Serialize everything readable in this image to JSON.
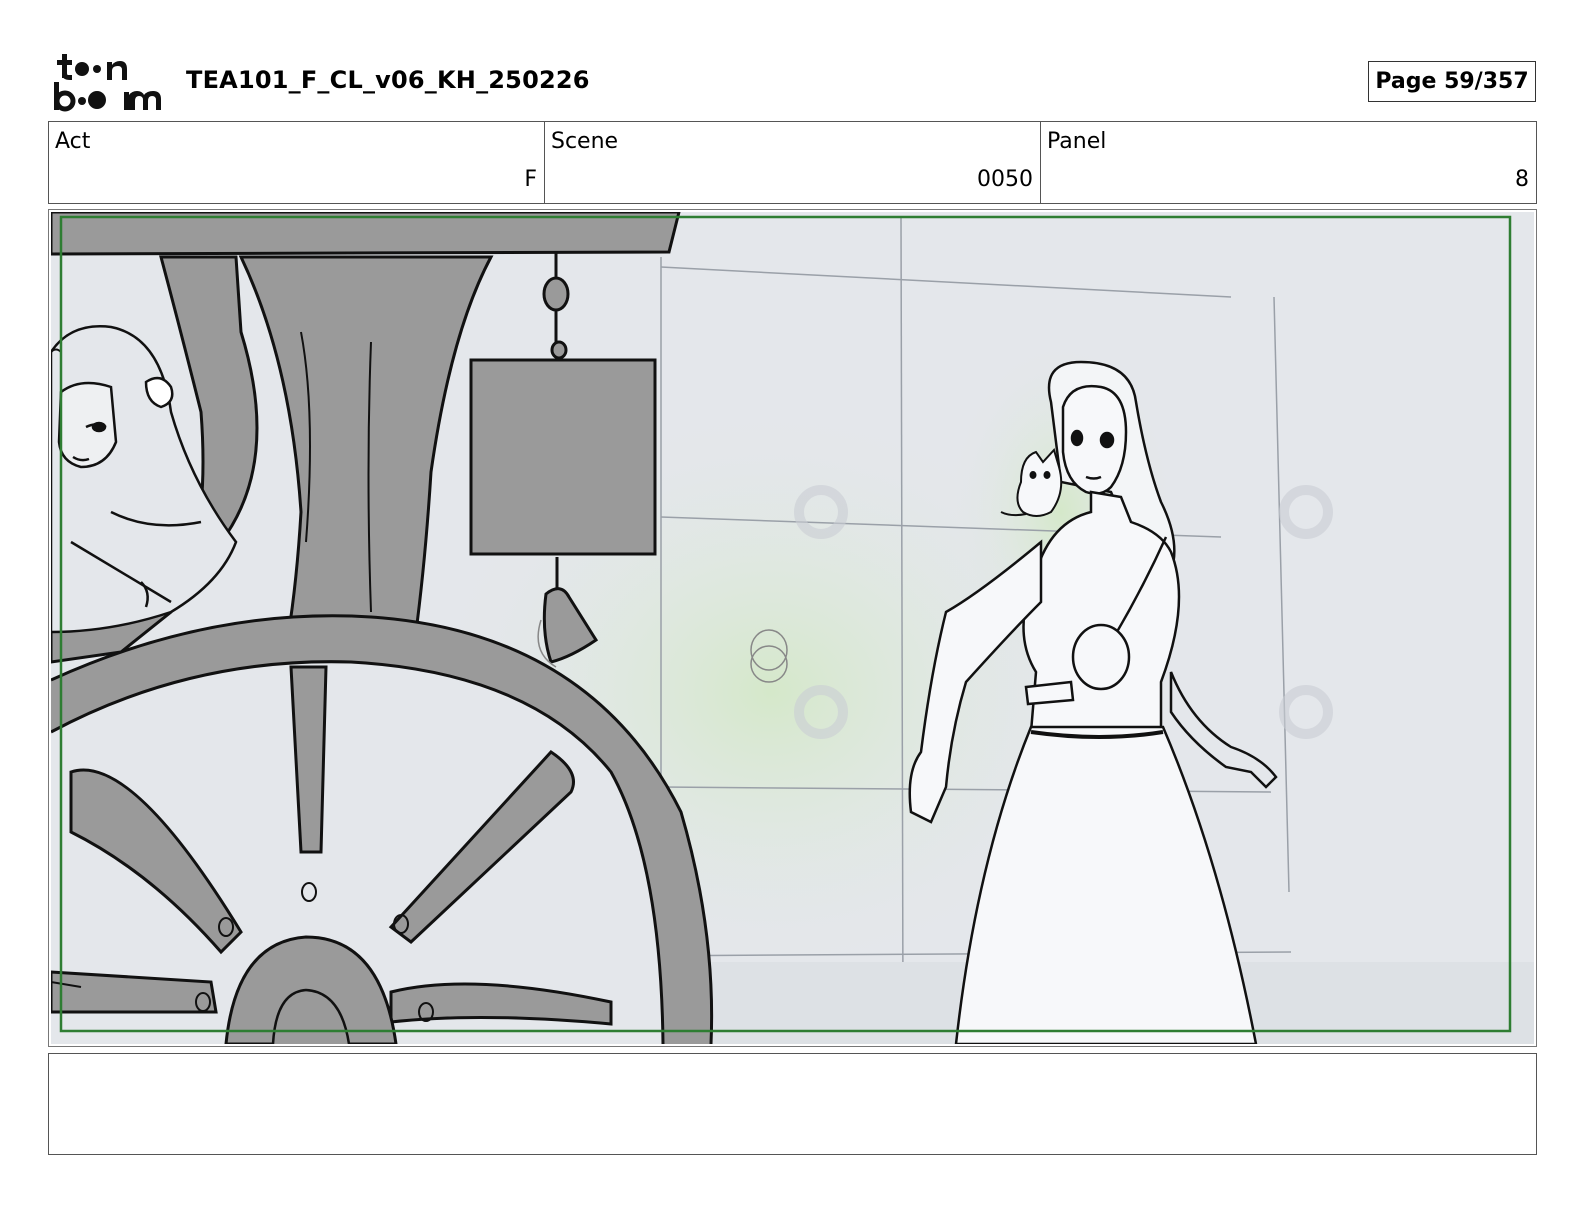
{
  "header": {
    "doc_title": "TEA101_F_CL_v06_KH_250226",
    "page_label": "Page  59/357",
    "logo": {
      "line1": "t●●n",
      "line2": "b●●m",
      "name": "toon-boom-logo"
    }
  },
  "info": {
    "act_label": "Act",
    "act_value": "F",
    "scene_label": "Scene",
    "scene_value": "0050",
    "panel_label": "Panel",
    "panel_value": "8"
  },
  "notes": {
    "text": ""
  },
  "colors": {
    "safe_frame": "#2e7d32",
    "cart_gray": "#9a9a9a",
    "sky": "#e5e8ec",
    "glow": "#cfe6c4"
  }
}
